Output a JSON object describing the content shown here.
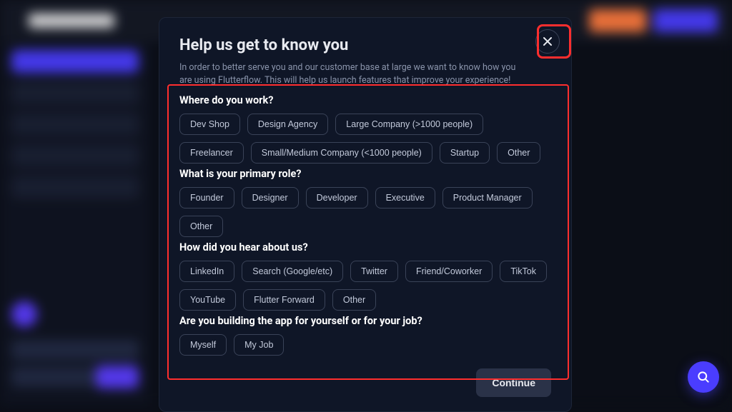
{
  "modal": {
    "title": "Help us get to know you",
    "subtitle": "In order to better serve you and our customer base at large we want to know how you are using Flutterflow. This will help us launch features that improve your experience!",
    "continue_label": "Continue",
    "sections": [
      {
        "question": "Where do you work?",
        "options": [
          "Dev Shop",
          "Design Agency",
          "Large Company (>1000 people)",
          "Freelancer",
          "Small/Medium Company (<1000 people)",
          "Startup",
          "Other"
        ]
      },
      {
        "question": "What is your primary role?",
        "options": [
          "Founder",
          "Designer",
          "Developer",
          "Executive",
          "Product Manager",
          "Other"
        ]
      },
      {
        "question": "How did you hear about us?",
        "options": [
          "LinkedIn",
          "Search (Google/etc)",
          "Twitter",
          "Friend/Coworker",
          "TikTok",
          "YouTube",
          "Flutter Forward",
          "Other"
        ]
      },
      {
        "question": "Are you building the app for yourself or for your job?",
        "options": [
          "Myself",
          "My Job"
        ]
      }
    ]
  },
  "colors": {
    "highlight": "#ff2e2e",
    "primary": "#4a3dff",
    "accent": "#ff7a3d"
  }
}
